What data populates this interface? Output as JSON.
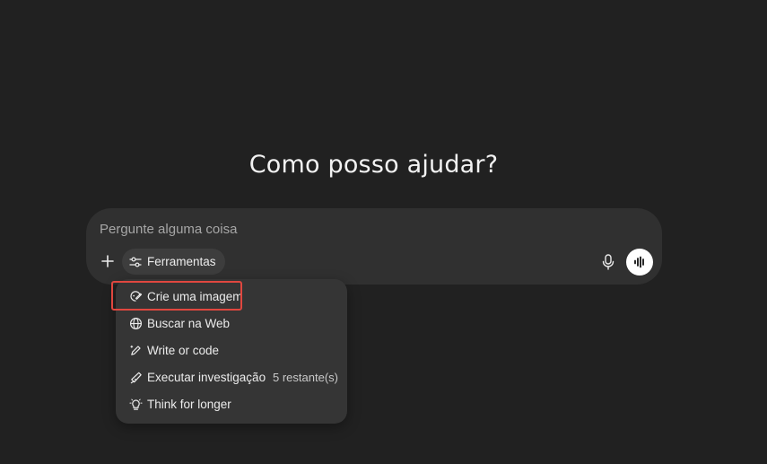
{
  "heading": "Como posso ajudar?",
  "composer": {
    "placeholder": "Pergunte alguma coisa",
    "value": "",
    "tools_label": "Ferramentas"
  },
  "tools_menu": {
    "items": [
      {
        "label": "Crie uma imagem",
        "icon": "image-brush-icon",
        "badge": ""
      },
      {
        "label": "Buscar na Web",
        "icon": "globe-icon",
        "badge": ""
      },
      {
        "label": "Write or code",
        "icon": "pen-sparkle-icon",
        "badge": ""
      },
      {
        "label": "Executar investigação",
        "icon": "telescope-icon",
        "badge": "5 restante(s)"
      },
      {
        "label": "Think for longer",
        "icon": "lightbulb-icon",
        "badge": ""
      }
    ]
  },
  "colors": {
    "background": "#212121",
    "composer": "#303030",
    "menu": "#353535",
    "highlight": "#e0473f"
  }
}
